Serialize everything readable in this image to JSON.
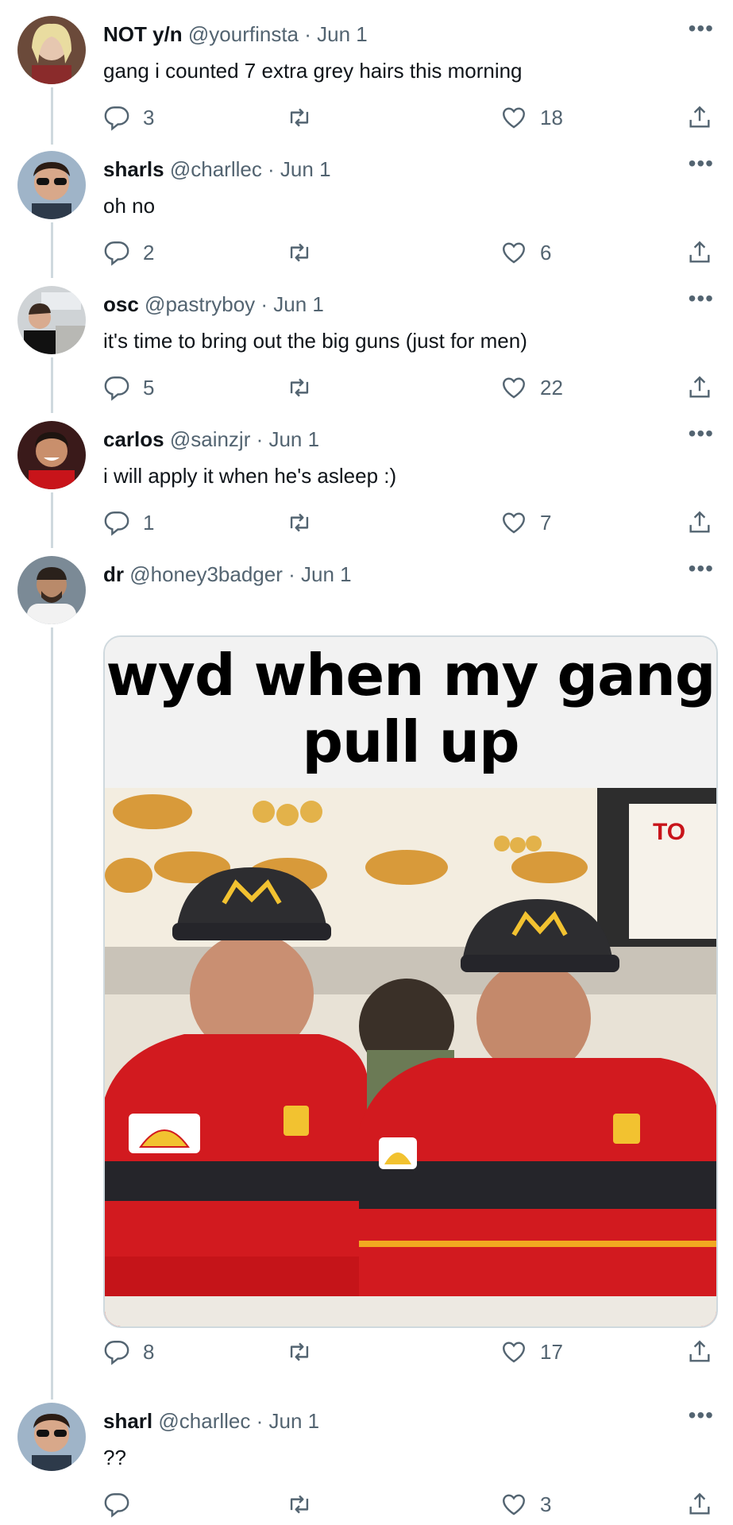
{
  "colors": {
    "text": "#0f1419",
    "secondary": "#536471",
    "thread_line": "#cfd9de"
  },
  "tweets": [
    {
      "name": "NOT y/n",
      "handle": "@yourfinsta · Jun 1",
      "text": "gang i counted 7 extra grey hairs this morning",
      "replies": "3",
      "retweets": "",
      "likes": "18"
    },
    {
      "name": "sharls",
      "handle": "@charllec · Jun 1",
      "text": "oh no",
      "replies": "2",
      "retweets": "",
      "likes": "6"
    },
    {
      "name": "osc",
      "handle": "@pastryboy · Jun 1",
      "text": "it's time to bring out the big guns (just for men)",
      "replies": "5",
      "retweets": "",
      "likes": "22"
    },
    {
      "name": "carlos",
      "handle": "@sainzjr · Jun 1",
      "text": "i will apply it when he's asleep :)",
      "replies": "1",
      "retweets": "",
      "likes": "7"
    },
    {
      "name": "dr",
      "handle": "@honey3badger · Jun 1",
      "text": "",
      "replies": "8",
      "retweets": "",
      "likes": "17",
      "media_caption": "wyd when my gang pull up"
    },
    {
      "name": "sharl",
      "handle": "@charllec · Jun 1",
      "text": "??",
      "replies": "",
      "retweets": "",
      "likes": "3"
    }
  ],
  "icons": [
    "more-icon",
    "reply-icon",
    "retweet-icon",
    "like-icon",
    "share-icon"
  ]
}
